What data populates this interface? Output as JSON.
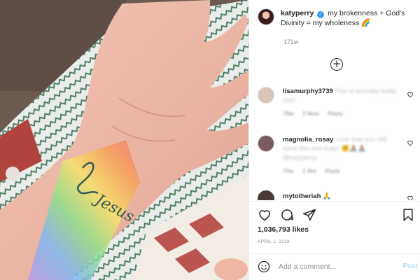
{
  "post": {
    "username": "katyperry",
    "caption": "my brokenness + God's Divinity = my wholeness",
    "caption_emoji": "🌈",
    "time_ago": "171w",
    "likes": "1,036,793 likes",
    "date": "APRIL 1, 2018",
    "tattoo_text": "Jesus"
  },
  "comments": [
    {
      "username": "lisamurphy3739",
      "text": "This is actually really cool",
      "time": "78w",
      "likes": "2 likes",
      "reply": "Reply",
      "avatar_color": "#d8c4b8"
    },
    {
      "username": "magnolia_rosay",
      "text": "Love that you still have this one Katy! 🤗🙏🏽🙏🏽 @katyperry",
      "time": "70w",
      "likes": "1 like",
      "reply": "Reply",
      "avatar_color": "#7a5b5e"
    },
    {
      "username": "mytotheriah",
      "text": "🙏",
      "avatar_color": "#4a3a36"
    }
  ],
  "actions": {
    "add_comment_placeholder": "Add a comment...",
    "post_label": "Post"
  },
  "icons": [
    "heart-icon",
    "comment-icon",
    "share-icon",
    "bookmark-icon",
    "emoji-icon",
    "plus-circle-icon"
  ],
  "colors": {
    "verified": "#3897f0",
    "post_button": "#b2dffc",
    "muted": "#8e8e8e"
  }
}
